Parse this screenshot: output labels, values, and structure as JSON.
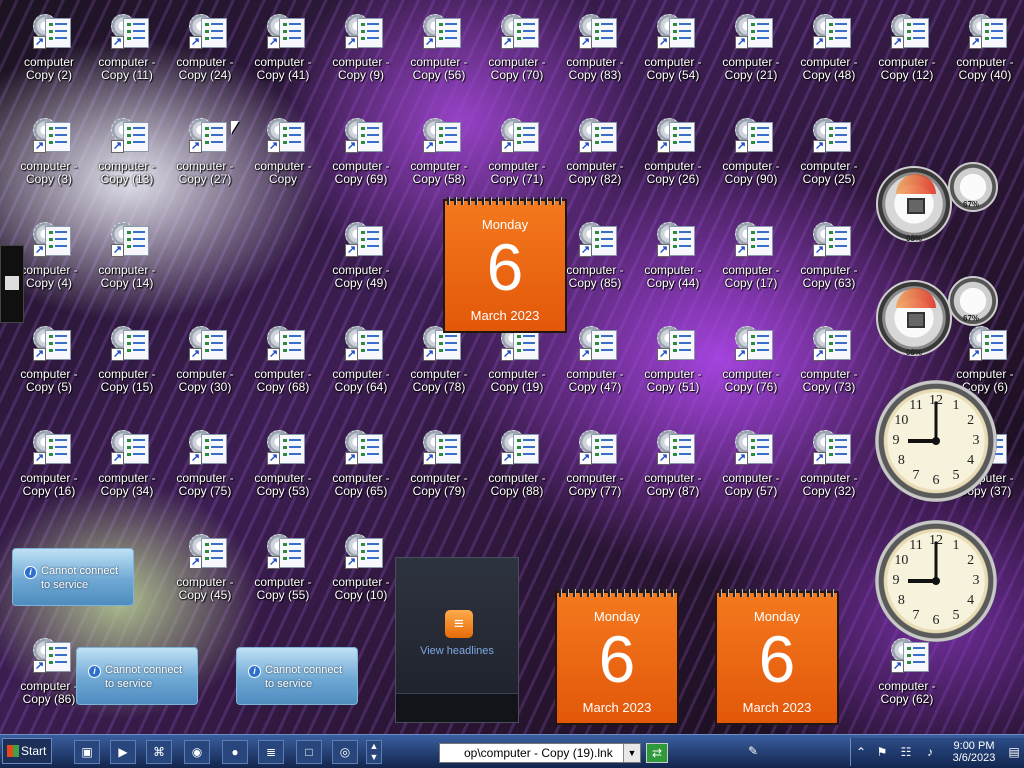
{
  "desktop": {
    "icon_line1": "computer -",
    "icons": [
      {
        "label": "Copy (2)",
        "line1": "computer"
      },
      {
        "label": "Copy (11)"
      },
      {
        "label": "Copy (24)"
      },
      {
        "label": "Copy (41)"
      },
      {
        "label": "Copy (9)"
      },
      {
        "label": "Copy (56)"
      },
      {
        "label": "Copy (70)"
      },
      {
        "label": "Copy (83)"
      },
      {
        "label": "Copy (54)"
      },
      {
        "label": "Copy (21)"
      },
      {
        "label": "Copy (48)"
      },
      {
        "label": "Copy (12)"
      },
      {
        "label": "Copy (40)"
      },
      {
        "label": "Copy (3)"
      },
      {
        "label": "Copy (13)"
      },
      {
        "label": "Copy (27)"
      },
      {
        "label": "Copy"
      },
      {
        "label": "Copy (69)"
      },
      {
        "label": "Copy (58)"
      },
      {
        "label": "Copy (71)"
      },
      {
        "label": "Copy (82)"
      },
      {
        "label": "Copy (26)"
      },
      {
        "label": "Copy (90)"
      },
      {
        "label": "Copy (25)"
      },
      {
        "label": "Copy (4)"
      },
      {
        "label": "Copy (14)"
      },
      {
        "label": "Copy (49)"
      },
      {
        "label": "Copy (85)"
      },
      {
        "label": "Copy (44)"
      },
      {
        "label": "Copy (17)"
      },
      {
        "label": "Copy (63)"
      },
      {
        "label": "Copy (5)"
      },
      {
        "label": "Copy (15)"
      },
      {
        "label": "Copy (30)"
      },
      {
        "label": "Copy (68)"
      },
      {
        "label": "Copy (64)"
      },
      {
        "label": "Copy (78)"
      },
      {
        "label": "Copy (19)"
      },
      {
        "label": "Copy (47)"
      },
      {
        "label": "Copy (51)"
      },
      {
        "label": "Copy (76)"
      },
      {
        "label": "Copy (73)"
      },
      {
        "label": "Copy (6)"
      },
      {
        "label": "Copy (16)"
      },
      {
        "label": "Copy (34)"
      },
      {
        "label": "Copy (75)"
      },
      {
        "label": "Copy (53)"
      },
      {
        "label": "Copy (65)"
      },
      {
        "label": "Copy (79)"
      },
      {
        "label": "Copy (88)"
      },
      {
        "label": "Copy (77)"
      },
      {
        "label": "Copy (87)"
      },
      {
        "label": "Copy (57)"
      },
      {
        "label": "Copy (32)"
      },
      {
        "label": "Copy (37)"
      },
      {
        "label": "Copy (45)"
      },
      {
        "label": "Copy (55)"
      },
      {
        "label": "Copy (10)"
      },
      {
        "label": "Copy (86)"
      },
      {
        "label": "Copy (62)"
      }
    ]
  },
  "calendar_gadgets": [
    {
      "day": "Monday",
      "date": "6",
      "month": "March 2023"
    },
    {
      "day": "Monday",
      "date": "6",
      "month": "March 2023"
    },
    {
      "day": "Monday",
      "date": "6",
      "month": "March 2023"
    }
  ],
  "weather_gadgets": [
    {
      "message": "Cannot connect to service"
    },
    {
      "message": "Cannot connect to service"
    },
    {
      "message": "Cannot connect to service"
    }
  ],
  "cpu_gadgets": [
    {
      "cpu": "08%",
      "memory": "67%"
    },
    {
      "cpu": "08%",
      "memory": "67%"
    }
  ],
  "clock_gadgets": {
    "numbers": [
      "12",
      "1",
      "2",
      "3",
      "4",
      "5",
      "6",
      "7",
      "8",
      "9",
      "10",
      "11"
    ],
    "time_hours": 9,
    "time_minutes": 0
  },
  "feed_gadget": {
    "link": "View headlines"
  },
  "taskbar": {
    "start_label": "Start",
    "address_value": "op\\computer - Copy (19).lnk",
    "clock_time": "9:00 PM",
    "clock_date": "3/6/2023"
  }
}
